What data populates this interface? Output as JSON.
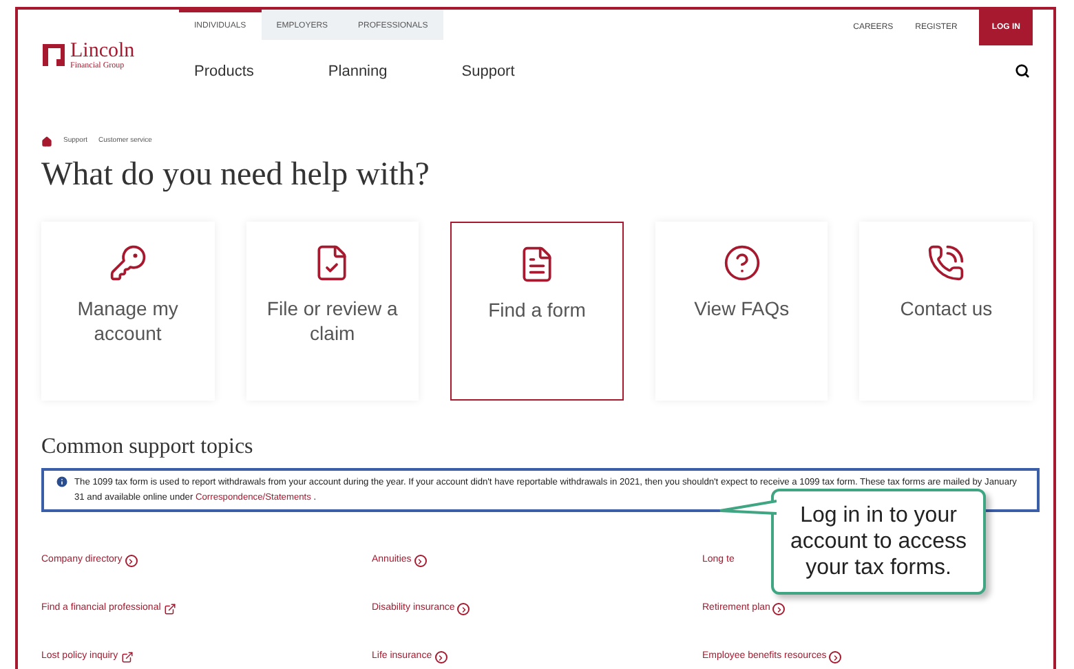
{
  "logo": {
    "name": "Lincoln",
    "subtitle": "Financial Group"
  },
  "audience_tabs": [
    {
      "label": "INDIVIDUALS",
      "selected": true
    },
    {
      "label": "EMPLOYERS",
      "selected": false
    },
    {
      "label": "PROFESSIONALS",
      "selected": false
    }
  ],
  "main_nav": [
    "Products",
    "Planning",
    "Support"
  ],
  "utility_links": [
    "CAREERS",
    "REGISTER"
  ],
  "login_button": "LOG IN",
  "breadcrumb": [
    "Support",
    "Customer service"
  ],
  "heading": "What do you need help with?",
  "cards": [
    {
      "kind": "key",
      "label": "Manage my account",
      "selected": false
    },
    {
      "kind": "claim",
      "label": "File or review a claim",
      "selected": false
    },
    {
      "kind": "form",
      "label": "Find a form",
      "selected": true
    },
    {
      "kind": "faq",
      "label": "View FAQs",
      "selected": false
    },
    {
      "kind": "contact",
      "label": "Contact us",
      "selected": false
    }
  ],
  "topics_heading": "Common support topics",
  "notice": {
    "text": "The 1099 tax form is used to report withdrawals from your account during the year. If your account didn't have reportable withdrawals in 2021, then you shouldn't expect to receive a 1099 tax form. These tax forms are mailed by January 31 and available online under",
    "link": "Correspondence/Statements",
    "end": "."
  },
  "topic_links": [
    {
      "label": "Company directory",
      "kind": "internal"
    },
    {
      "label": "Annuities",
      "kind": "internal"
    },
    {
      "label": "Long te",
      "kind": "plain"
    },
    {
      "label": "Find a financial professional",
      "kind": "external"
    },
    {
      "label": "Disability insurance",
      "kind": "internal"
    },
    {
      "label": "Retirement plan",
      "kind": "internal"
    },
    {
      "label": "Lost policy inquiry",
      "kind": "external"
    },
    {
      "label": "Life insurance",
      "kind": "internal"
    },
    {
      "label": "Employee benefits resources",
      "kind": "internal"
    }
  ],
  "callout": "Log in in to your account to access your tax forms."
}
